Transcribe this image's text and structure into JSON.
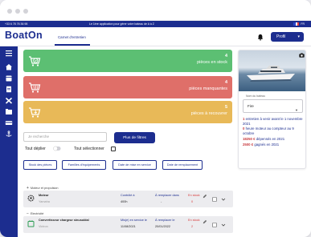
{
  "topbar": {
    "phone": "+33 6 78 76 36 98",
    "promo": "Le 1ère application pour gérer votre bateau de A à Z",
    "lang": "FR"
  },
  "header": {
    "logo": "BoatOn",
    "nav_tab": "Carnet d'entretien",
    "profile_label": "Profil"
  },
  "stock_cards": [
    {
      "count": "4",
      "label": "pièces en stock",
      "color": "#5cbf73"
    },
    {
      "count": "4",
      "label": "pièces manquantes",
      "color": "#df6f69"
    },
    {
      "count": "5",
      "label": "pièces à recouvrer",
      "color": "#e8b958"
    }
  ],
  "boat": {
    "field_label": "Nom du bateau",
    "name": "Fire",
    "lines": [
      {
        "strong": "1",
        "text": " entretien à venir avant le 1 novembre 2021"
      },
      {
        "strong": "0",
        "text": " heure moteur au compteur au 9 octobre"
      },
      {
        "strong": "18250 €",
        "text": " dépensés en 2021"
      },
      {
        "strong": "2500 €",
        "text": " gagnés en 2021"
      }
    ]
  },
  "search": {
    "placeholder": "Je recherche"
  },
  "filters_button": "Plus de filtres",
  "toggles": {
    "deploy": "Tout déplier",
    "select_all": "Tout sélectionner"
  },
  "sort_pills": [
    "Stock des pièces",
    "Familles d'équipements",
    "Date de mise en service",
    "Date de remplacement"
  ],
  "groups": [
    {
      "title": "Moteur et propulsion",
      "rows": [
        {
          "name": "Moteur",
          "brand": "Yamaha",
          "col1_label": "Contrôlé à",
          "col1_value": "400h",
          "col2_label": "À remplacer dans",
          "col2_value": "-",
          "col3_label": "En stock",
          "col3_value": "0"
        }
      ]
    },
    {
      "title": "Electricité",
      "rows": [
        {
          "name": "Convertisseur chargeur sinusoïdal",
          "brand": "Victron",
          "col1_label": "Mis(e) en service le",
          "col1_value": "11/08/2021",
          "col2_label": "À remplacer le",
          "col2_value": "20/01/2022",
          "col3_label": "En stock",
          "col3_value": "2"
        }
      ]
    }
  ],
  "colors": {
    "brand": "#1c2d8f",
    "alert": "#d83a3a"
  }
}
